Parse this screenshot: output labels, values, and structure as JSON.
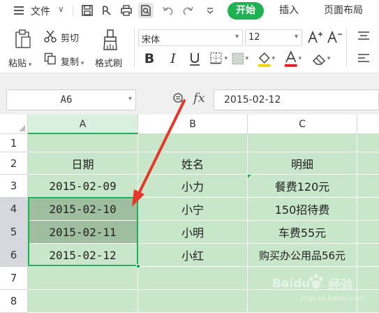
{
  "toolbar": {
    "file_label": "文件",
    "tabs": [
      {
        "label": "开始",
        "active": true
      },
      {
        "label": "插入",
        "active": false
      },
      {
        "label": "页面布局",
        "active": false
      }
    ]
  },
  "ribbon": {
    "paste_label": "粘贴",
    "cut_label": "剪切",
    "copy_label": "复制",
    "format_painter_label": "格式刷",
    "font_name": "宋体",
    "font_size": "12",
    "font_color": "#e02020",
    "highlight_color": "#f5d200"
  },
  "formula_bar": {
    "name_box": "A6",
    "fx_label": "fx",
    "formula_value": "2015-02-12"
  },
  "sheet": {
    "columns": [
      "A",
      "B",
      "C"
    ],
    "rows": [
      "1",
      "2",
      "3",
      "4",
      "5",
      "6",
      "7",
      "8"
    ],
    "header_row": [
      "日期",
      "姓名",
      "明细"
    ],
    "data": [
      [
        "2015-02-09",
        "小力",
        "餐费120元"
      ],
      [
        "2015-02-10",
        "小宁",
        "150招待费"
      ],
      [
        "2015-02-11",
        "小明",
        "车费55元"
      ],
      [
        "2015-02-12",
        "小红",
        "购买办公用品56元"
      ]
    ],
    "selected_range": "A4:A6",
    "fill_color": "#c8e6c9",
    "accent_color": "#1eb254"
  },
  "annotation": {
    "arrow_color": "#e8362b"
  },
  "watermark": {
    "brand": "Baidu",
    "word": "经验",
    "url": "jingyan.baidu.com"
  }
}
